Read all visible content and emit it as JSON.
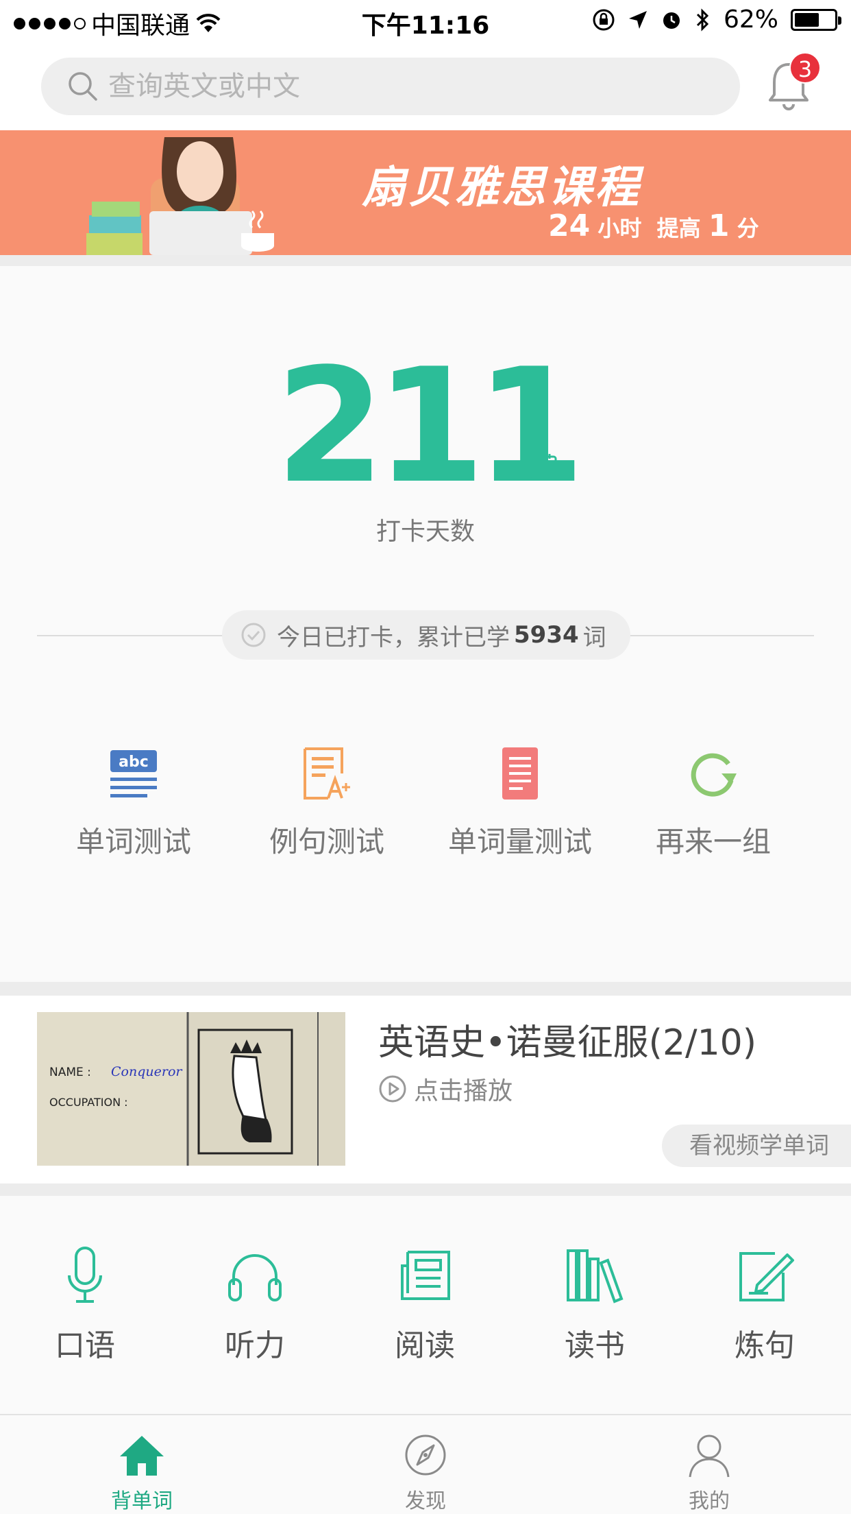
{
  "status_bar": {
    "carrier": "中国联通",
    "time": "下午11:16",
    "battery": "62%",
    "battery_level": 0.62
  },
  "search": {
    "placeholder": "查询英文或中文",
    "notification_count": "3"
  },
  "banner": {
    "title": "扇贝雅思课程",
    "sub_num1": "24",
    "sub_text1": "小时",
    "sub_text2": "提高",
    "sub_num2": "1",
    "sub_text3": "分"
  },
  "checkin": {
    "days": "211",
    "days_label": "打卡天数",
    "status_prefix": "今日已打卡，累计已学",
    "words_count": "5934",
    "status_suffix": "词"
  },
  "tests": [
    {
      "label": "单词测试",
      "icon": "abc-icon"
    },
    {
      "label": "例句测试",
      "icon": "sentence-test-icon"
    },
    {
      "label": "单词量测试",
      "icon": "document-icon"
    },
    {
      "label": "再来一组",
      "icon": "refresh-icon"
    }
  ],
  "video": {
    "title": "英语史•诺曼征服(2/10)",
    "play_label": "点击播放",
    "pill_label": "看视频学单词",
    "thumb_name_label": "NAME :",
    "thumb_name_value": "Conqueror",
    "thumb_occupation_label": "OCCUPATION :"
  },
  "skills": [
    {
      "label": "口语",
      "icon": "microphone-icon"
    },
    {
      "label": "听力",
      "icon": "headphones-icon"
    },
    {
      "label": "阅读",
      "icon": "reading-icon"
    },
    {
      "label": "读书",
      "icon": "books-icon"
    },
    {
      "label": "炼句",
      "icon": "pencil-note-icon"
    }
  ],
  "tabbar": [
    {
      "label": "背单词",
      "icon": "home-icon",
      "active": true
    },
    {
      "label": "发现",
      "icon": "compass-icon",
      "active": false
    },
    {
      "label": "我的",
      "icon": "profile-icon",
      "active": false
    }
  ],
  "colors": {
    "accent": "#2cbd98",
    "banner": "#f79170",
    "badge": "#e8313c"
  }
}
